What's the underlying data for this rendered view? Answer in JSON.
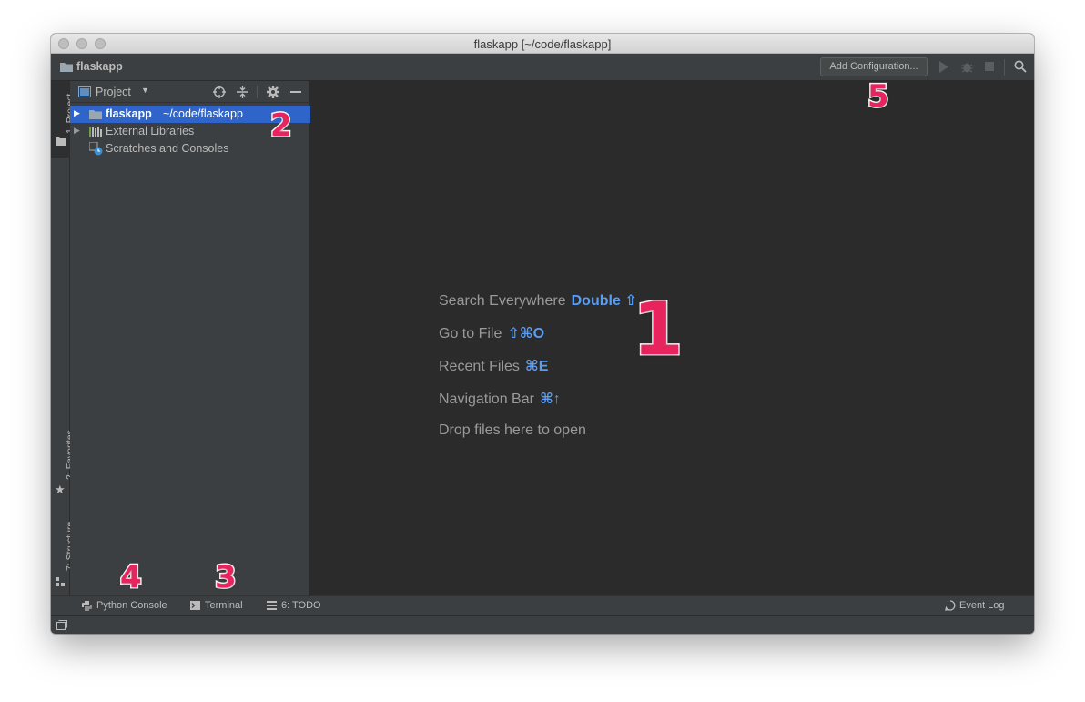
{
  "window": {
    "title": "flaskapp [~/code/flaskapp]"
  },
  "navbar": {
    "project_name": "flaskapp",
    "add_configuration_label": "Add Configuration...",
    "icons": [
      "run-icon",
      "debug-icon",
      "stop-icon",
      "search-icon"
    ]
  },
  "left_strip": {
    "tabs": [
      {
        "label": "1: Project",
        "icon": "folder-icon",
        "active": true
      },
      {
        "label": "2: Favorites",
        "icon": "star-icon",
        "active": false
      },
      {
        "label": "7: Structure",
        "icon": "structure-icon",
        "active": false
      }
    ]
  },
  "project_panel": {
    "title": "Project",
    "header_icons": [
      "locate-icon",
      "collapse-all-icon",
      "settings-gear-icon",
      "hide-minus-icon"
    ],
    "tree": [
      {
        "name": "flaskapp",
        "path": "~/code/flaskapp",
        "selected": true,
        "icon": "folder-icon"
      },
      {
        "name": "External Libraries",
        "selected": false,
        "icon": "library-icon"
      },
      {
        "name": "Scratches and Consoles",
        "selected": false,
        "icon": "scratches-icon"
      }
    ]
  },
  "editor": {
    "hints": [
      {
        "label": "Search Everywhere",
        "shortcut": "Double ⇧"
      },
      {
        "label": "Go to File",
        "shortcut": "⇧⌘O"
      },
      {
        "label": "Recent Files",
        "shortcut": "⌘E"
      },
      {
        "label": "Navigation Bar",
        "shortcut": "⌘↑"
      },
      {
        "label": "Drop files here to open",
        "shortcut": ""
      }
    ]
  },
  "bottom_tabs": {
    "python_console": "Python Console",
    "terminal": "Terminal",
    "todo": "6: TODO",
    "event_log": "Event Log"
  },
  "annotations": [
    "1",
    "2",
    "3",
    "4",
    "5"
  ],
  "colors": {
    "editor_bg": "#2b2b2b",
    "panel_bg": "#3c3f41",
    "selection": "#2f65ca",
    "shortcut_blue": "#589df6",
    "annotation_pink": "#e8245e"
  }
}
